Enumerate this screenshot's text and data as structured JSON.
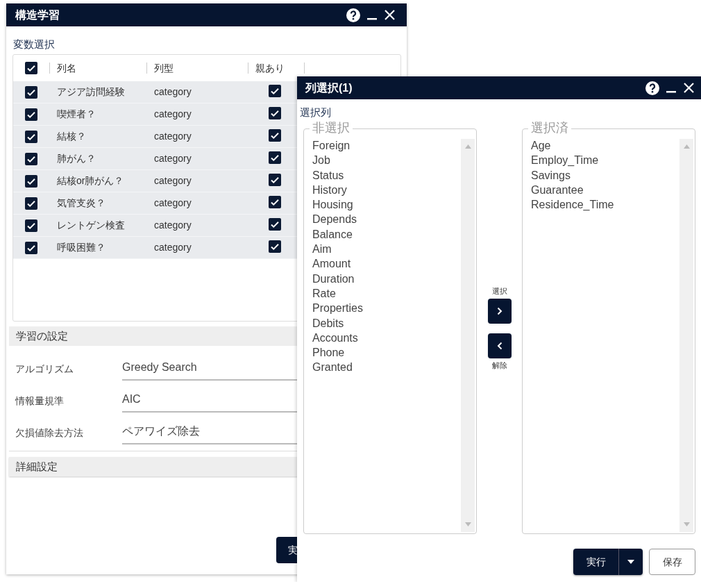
{
  "main_window": {
    "title": "構造学習",
    "variable_section": {
      "label": "変数選択",
      "header_checked": true,
      "columns": [
        "列名",
        "列型",
        "親あり"
      ],
      "rows": [
        {
          "checked": true,
          "name": "アジア訪問経験",
          "type": "category",
          "parent": true
        },
        {
          "checked": true,
          "name": "喫煙者？",
          "type": "category",
          "parent": true
        },
        {
          "checked": true,
          "name": "結核？",
          "type": "category",
          "parent": true
        },
        {
          "checked": true,
          "name": "肺がん？",
          "type": "category",
          "parent": true
        },
        {
          "checked": true,
          "name": "結核or肺がん？",
          "type": "category",
          "parent": true
        },
        {
          "checked": true,
          "name": "気管支炎？",
          "type": "category",
          "parent": true
        },
        {
          "checked": true,
          "name": "レントゲン検査",
          "type": "category",
          "parent": true
        },
        {
          "checked": true,
          "name": "呼吸困難？",
          "type": "category",
          "parent": true
        }
      ]
    },
    "learning_settings": {
      "title": "学習の設定",
      "fields": [
        {
          "label": "アルゴリズム",
          "value": "Greedy Search"
        },
        {
          "label": "情報量規準",
          "value": "AIC"
        },
        {
          "label": "欠損値除去方法",
          "value": "ペアワイズ除去"
        }
      ]
    },
    "advanced_settings": {
      "title": "詳細設定"
    },
    "run_button": "実"
  },
  "dialog": {
    "title": "列選択(1)",
    "section_label": "選択列",
    "unselected": {
      "legend": "非選択",
      "items": [
        "Foreign",
        "Job",
        "Status",
        "History",
        "Housing",
        "Depends",
        "Balance",
        "Aim",
        "Amount",
        "Duration",
        "Rate",
        "Properties",
        "Debits",
        "Accounts",
        "Phone",
        "Granted"
      ]
    },
    "selected": {
      "legend": "選択済",
      "items": [
        "Age",
        "Employ_Time",
        "Savings",
        "Guarantee",
        "Residence_Time"
      ]
    },
    "add_label": "選択",
    "remove_label": "解除",
    "run_button": "実行",
    "save_button": "保存"
  }
}
